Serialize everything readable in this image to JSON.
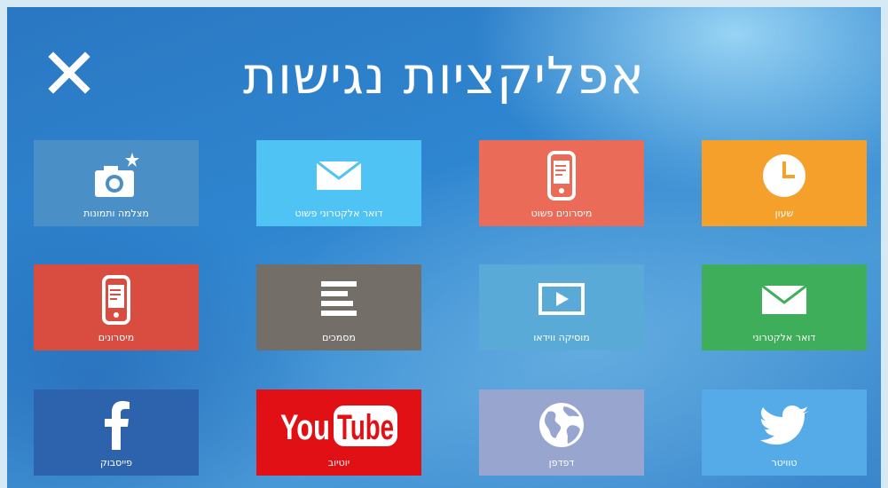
{
  "title": "אפליקציות נגישות",
  "close_icon": "close-icon",
  "tiles": [
    {
      "label": "שעון",
      "icon": "clock-icon",
      "color": "#f5a02a"
    },
    {
      "label": "מיסרונים פשוט",
      "icon": "phone-icon",
      "color": "#ea6b57"
    },
    {
      "label": "דואר אלקטרוני פשוט",
      "icon": "mail-icon",
      "color": "#4fc3f4"
    },
    {
      "label": "מצלמה ותמונות",
      "icon": "camera-icon",
      "color": "#4a8fc6"
    },
    {
      "label": "דואר אלקטרוני",
      "icon": "mail-icon",
      "color": "#3fae5a"
    },
    {
      "label": "מוסיקה ווידאו",
      "icon": "video-icon",
      "color": "#5aaad8"
    },
    {
      "label": "מסמכים",
      "icon": "document-icon",
      "color": "#736e68"
    },
    {
      "label": "מיסרונים",
      "icon": "phone-icon",
      "color": "#d94c40"
    },
    {
      "label": "טוויטר",
      "icon": "twitter-icon",
      "color": "#55abe8"
    },
    {
      "label": "דפדפן",
      "icon": "globe-icon",
      "color": "#98a6cf"
    },
    {
      "label": "יוטיוב",
      "icon": "youtube-logo",
      "color": "#e01014",
      "logo_text_1": "You",
      "logo_text_2": "Tube"
    },
    {
      "label": "פייסבוק",
      "icon": "facebook-icon",
      "color": "#2d62ad"
    }
  ]
}
